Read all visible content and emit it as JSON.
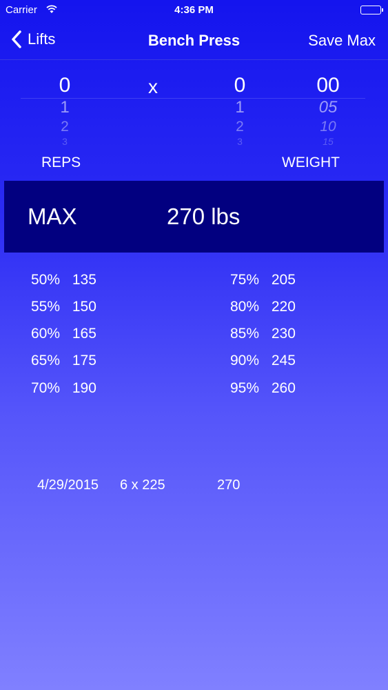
{
  "status_bar": {
    "carrier": "Carrier",
    "time": "4:36 PM"
  },
  "nav": {
    "back_label": "Lifts",
    "title": "Bench Press",
    "save_label": "Save Max"
  },
  "picker": {
    "reps": [
      "0",
      "1",
      "2",
      "3"
    ],
    "separator": "x",
    "weight_main": [
      "0",
      "1",
      "2",
      "3"
    ],
    "weight_fraction": [
      "00",
      "05",
      "10",
      "15"
    ]
  },
  "labels": {
    "reps": "REPS",
    "weight": "WEIGHT"
  },
  "max": {
    "label": "MAX",
    "value": "270 lbs"
  },
  "percentages_left": [
    {
      "pct": "50%",
      "value": "135"
    },
    {
      "pct": "55%",
      "value": "150"
    },
    {
      "pct": "60%",
      "value": "165"
    },
    {
      "pct": "65%",
      "value": "175"
    },
    {
      "pct": "70%",
      "value": "190"
    }
  ],
  "percentages_right": [
    {
      "pct": "75%",
      "value": "205"
    },
    {
      "pct": "80%",
      "value": "220"
    },
    {
      "pct": "85%",
      "value": "230"
    },
    {
      "pct": "90%",
      "value": "245"
    },
    {
      "pct": "95%",
      "value": "260"
    }
  ],
  "history": [
    {
      "date": "4/29/2015",
      "set": "6 x 225",
      "max": "270"
    }
  ],
  "colors": {
    "max_panel": "#020080",
    "background_top": "#1414ee",
    "background_bottom": "#8080ff"
  }
}
